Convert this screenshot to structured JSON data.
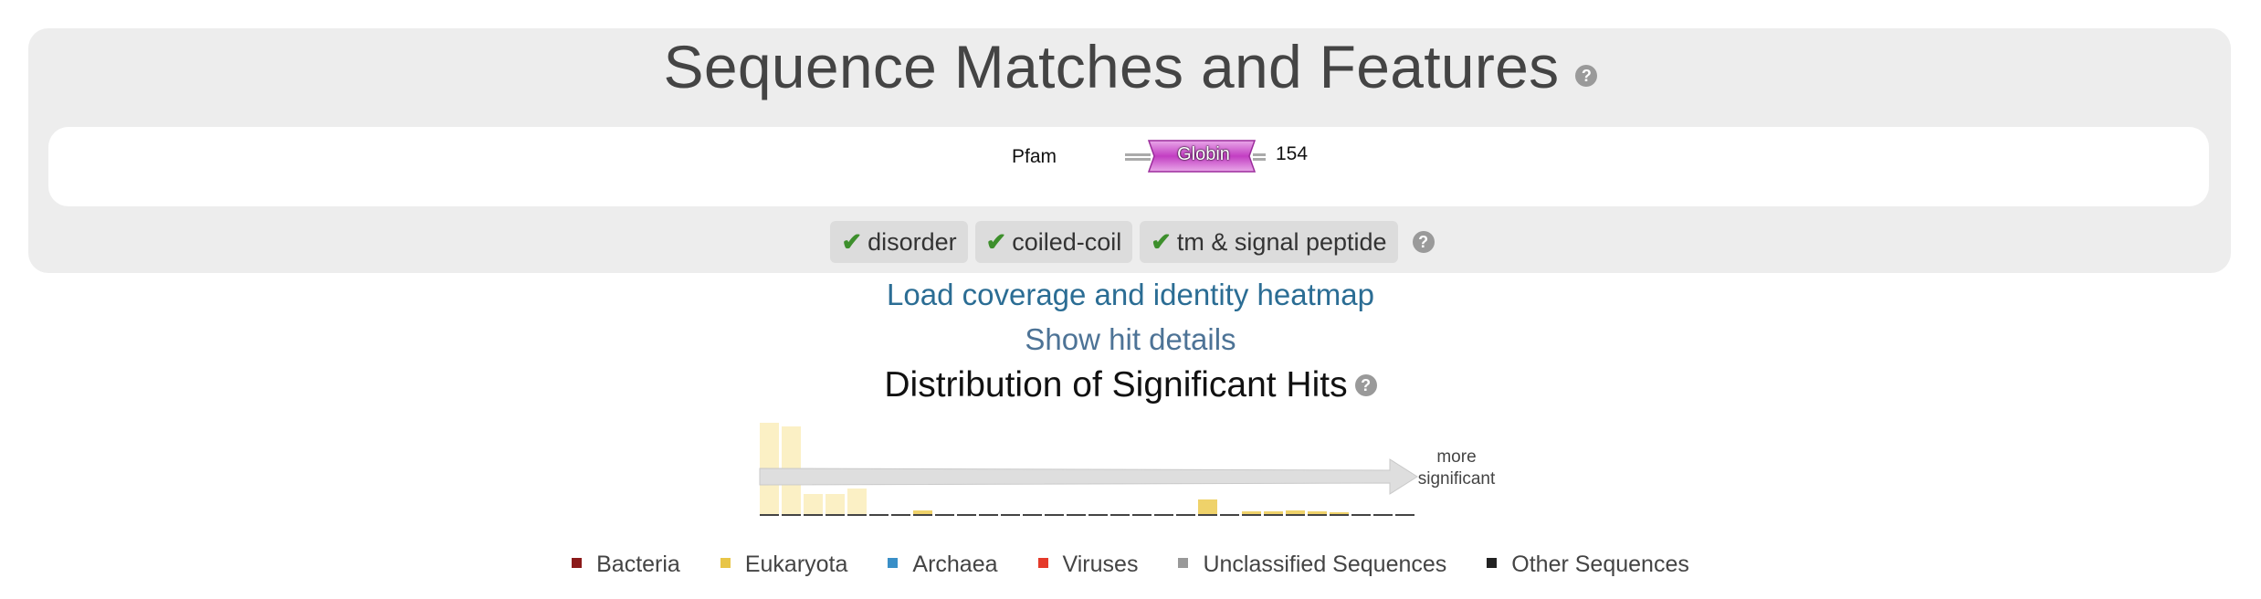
{
  "panel": {
    "title": "Sequence Matches and Features",
    "help_glyph": "?",
    "track": {
      "label": "Pfam",
      "domain_name": "Globin",
      "end_position": "154",
      "domain_color": "#c040c0"
    },
    "toggles": [
      {
        "label": "disorder",
        "checked": true
      },
      {
        "label": "coiled-coil",
        "checked": true
      },
      {
        "label": "tm & signal peptide",
        "checked": true
      }
    ],
    "check_glyph": "✔"
  },
  "links": {
    "heatmap": "Load coverage and identity heatmap",
    "hit_details": "Show hit details"
  },
  "distribution": {
    "title": "Distribution of Significant Hits",
    "arrow_label_line1": "more",
    "arrow_label_line2": "significant"
  },
  "chart_data": {
    "type": "bar",
    "bins": 30,
    "series": [
      {
        "name": "Eukaryota",
        "color": "#fbf0c5",
        "values": [
          100,
          96,
          22,
          22,
          28,
          0,
          0,
          0,
          0,
          0,
          0,
          0,
          0,
          0,
          0,
          0,
          0,
          0,
          0,
          0,
          0,
          0,
          0,
          0,
          0,
          0,
          0,
          0,
          0,
          0
        ]
      },
      {
        "name": "Eukaryota (highlighted)",
        "color": "#efd26a",
        "values": [
          0,
          0,
          0,
          0,
          0,
          0,
          0,
          0,
          0,
          0,
          0,
          0,
          0,
          0,
          0,
          0,
          0,
          0,
          0,
          0,
          16,
          0,
          0,
          0,
          0,
          0,
          0,
          0,
          0,
          0
        ]
      },
      {
        "name": "Eukaryota (trace)",
        "color": "#efd26a",
        "values": [
          0,
          0,
          0,
          0,
          0,
          0,
          0,
          4,
          0,
          0,
          0,
          0,
          0,
          0,
          0,
          0,
          0,
          0,
          0,
          0,
          0,
          0,
          3,
          3,
          4,
          3,
          2,
          0,
          0,
          0
        ]
      }
    ],
    "baseline_color": "#444444",
    "arrow_color": "#dedede"
  },
  "legend": [
    {
      "label": "Bacteria",
      "color": "#8b1a1a"
    },
    {
      "label": "Eukaryota",
      "color": "#e8c547"
    },
    {
      "label": "Archaea",
      "color": "#3a8fc7"
    },
    {
      "label": "Viruses",
      "color": "#e53a2a"
    },
    {
      "label": "Unclassified Sequences",
      "color": "#999999"
    },
    {
      "label": "Other Sequences",
      "color": "#222222"
    }
  ]
}
